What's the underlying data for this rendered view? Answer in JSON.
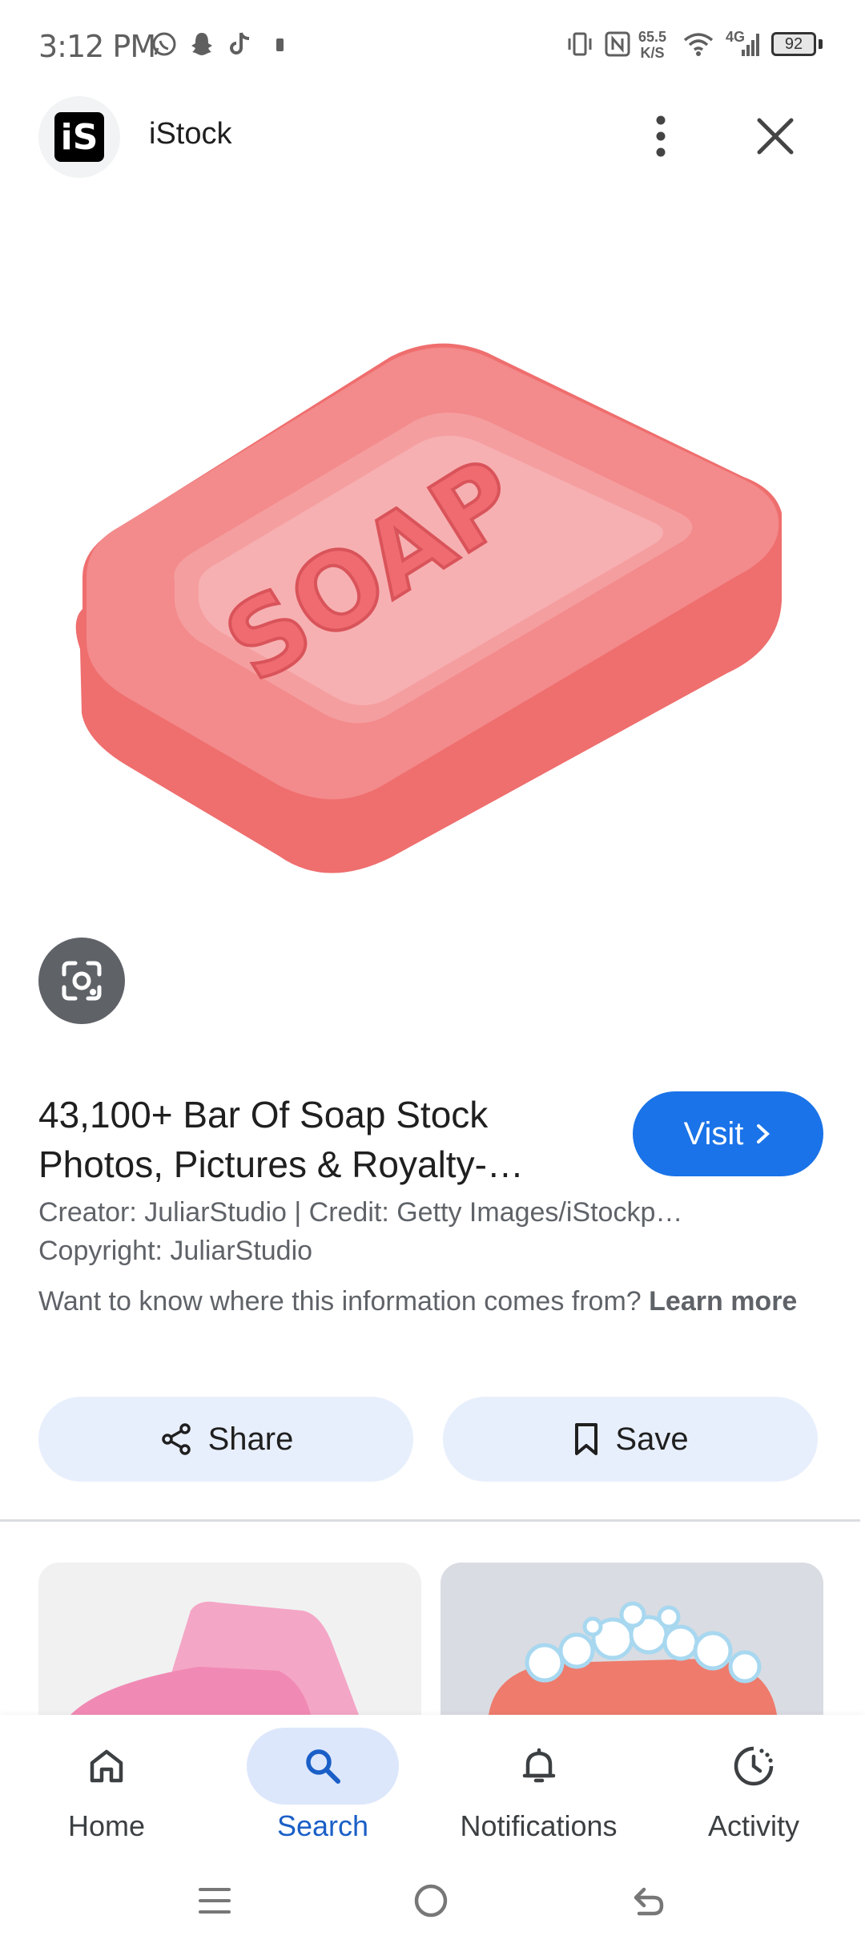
{
  "status_bar": {
    "time": "3:12 PM",
    "net_speed_value": "65.5",
    "net_speed_unit": "K/S",
    "network": "4G",
    "battery": "92"
  },
  "header": {
    "logo_text": "iS",
    "site_name": "iStock"
  },
  "image": {
    "text_on_soap": "SOAP"
  },
  "result": {
    "title": "43,100+ Bar Of Soap Stock Photos, Pictures & Royalty-…",
    "visit_label": "Visit",
    "creator_line": "Creator: JuliarStudio | Credit: Getty Images/iStockp…",
    "copyright_line": "Copyright: JuliarStudio",
    "info_text": "Want to know where this information comes from?",
    "learn_more": "Learn more"
  },
  "actions": {
    "share_label": "Share",
    "save_label": "Save"
  },
  "bottom_nav": {
    "items": [
      {
        "label": "Home",
        "icon": "home-icon"
      },
      {
        "label": "Search",
        "icon": "search-icon",
        "active": true
      },
      {
        "label": "Notifications",
        "icon": "bell-icon"
      },
      {
        "label": "Activity",
        "icon": "activity-icon"
      }
    ]
  },
  "colors": {
    "accent": "#1a73e8",
    "pill_bg": "#e8effc",
    "soap": "#f07272"
  }
}
